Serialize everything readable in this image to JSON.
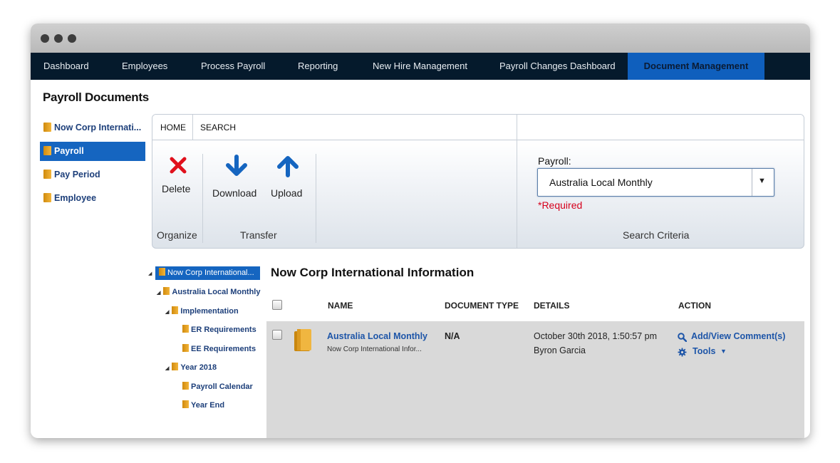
{
  "nav": {
    "items": [
      "Dashboard",
      "Employees",
      "Process Payroll",
      "Reporting",
      "New Hire Management",
      "Payroll Changes Dashboard",
      "Document Management"
    ]
  },
  "page": {
    "title": "Payroll Documents"
  },
  "sidebar": {
    "items": [
      "Now Corp Internati...",
      "Payroll",
      "Pay Period",
      "Employee"
    ]
  },
  "ribbon": {
    "tabs": [
      "HOME",
      "SEARCH"
    ],
    "delete_label": "Delete",
    "download_label": "Download",
    "upload_label": "Upload",
    "group_organize": "Organize",
    "group_transfer": "Transfer",
    "group_search": "Search Criteria",
    "payroll_label": "Payroll:",
    "payroll_value": "Australia Local Monthly",
    "required_text": "*Required"
  },
  "tree": {
    "root": "Now Corp International...",
    "child": "Australia Local Monthly",
    "implementation": "Implementation",
    "er": "ER Requirements",
    "ee": "EE Requirements",
    "year": "Year 2018",
    "calendar": "Payroll Calendar",
    "yearend": "Year End"
  },
  "content": {
    "title": "Now Corp International Information",
    "headers": {
      "name": "NAME",
      "doctype": "DOCUMENT TYPE",
      "details": "DETAILS",
      "action": "ACTION"
    },
    "row": {
      "name": "Australia Local Monthly",
      "subtitle": "Now Corp International Infor...",
      "doctype": "N/A",
      "date": "October 30th 2018, 1:50:57 pm",
      "user": "Byron Garcia",
      "comment_link": "Add/View Comment(s)",
      "tools_link": "Tools"
    }
  },
  "colors": {
    "nav_bg": "#051a2c",
    "accent": "#1565c0",
    "required": "#d6001c",
    "delete_red": "#e0101c",
    "arrow_blue": "#1565c0"
  }
}
